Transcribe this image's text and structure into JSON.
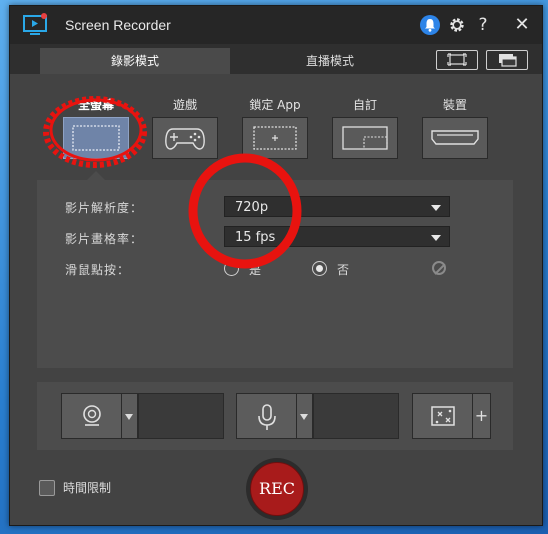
{
  "window": {
    "title": "Screen Recorder",
    "icons": [
      "app-logo-icon",
      "bell-icon",
      "gear-icon",
      "help-icon",
      "close-icon"
    ],
    "help_glyph": "?",
    "close_glyph": "✕"
  },
  "tabs": [
    {
      "label": "錄影模式",
      "active": true
    },
    {
      "label": "直播模式",
      "active": false
    }
  ],
  "modes": [
    {
      "label": "全螢幕",
      "icon": "fullscreen-icon",
      "active": true
    },
    {
      "label": "遊戲",
      "icon": "gamepad-icon",
      "active": false
    },
    {
      "label": "鎖定 App",
      "icon": "lock-app-icon",
      "active": false
    },
    {
      "label": "自訂",
      "icon": "custom-region-icon",
      "active": false
    },
    {
      "label": "裝置",
      "icon": "hdmi-device-icon",
      "active": false
    }
  ],
  "settings": {
    "resolution_label": "影片解析度：",
    "resolution_value": "720p",
    "framerate_label": "影片畫格率：",
    "framerate_value": "15 fps",
    "mouse_label": "滑鼠點按：",
    "mouse_options": [
      {
        "label": "是",
        "selected": false
      },
      {
        "label": "否",
        "selected": true
      }
    ]
  },
  "devices": {
    "plus": "+",
    "icons": [
      "webcam-icon",
      "microphone-icon",
      "effects-icon"
    ]
  },
  "footer": {
    "time_limit_label": "時間限制",
    "time_limit_checked": false,
    "rec_label": "REC"
  },
  "colors": {
    "accent_blue": "#2d84e8",
    "rec_red": "#a81b1b",
    "annotation_red": "#e8130f",
    "active_mode": "#6f84a8"
  }
}
